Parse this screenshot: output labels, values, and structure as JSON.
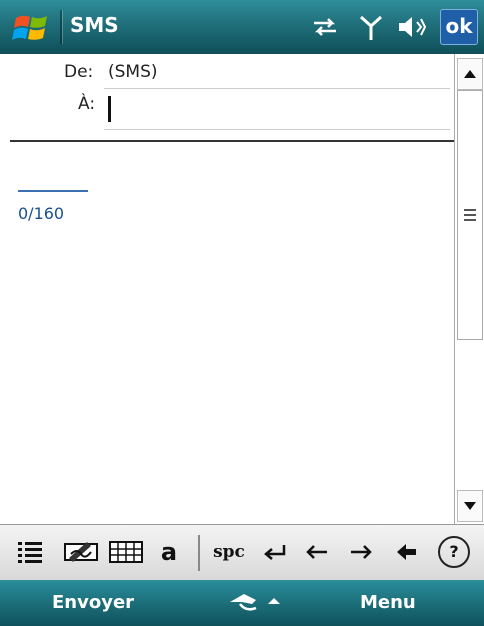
{
  "status_bar": {
    "app_title": "SMS",
    "icons": [
      "windows-logo",
      "connectivity-arrows-icon",
      "signal-antenna-icon",
      "speaker-volume-icon"
    ],
    "ok_label": "ok"
  },
  "message": {
    "from_label": "De:",
    "from_value": "(SMS)",
    "to_label": "À:",
    "to_value": "",
    "char_counter": "0/160"
  },
  "input_panel": {
    "items": [
      "list-icon",
      "handwriting-icon",
      "keyboard-icon",
      "letter-recognizer"
    ],
    "letter_label": "a",
    "space_label": "spc",
    "keys": [
      "enter-icon",
      "arrow-left-icon",
      "arrow-right-icon",
      "backspace-icon"
    ],
    "help_label": "?"
  },
  "softkeys": {
    "left_label": "Envoyer",
    "right_label": "Menu"
  },
  "colors": {
    "bar_top": "#2f8e9a",
    "bar_bottom": "#0e4f58",
    "ok_button": "#1f5fa8",
    "counter_text": "#1a4f8f"
  }
}
